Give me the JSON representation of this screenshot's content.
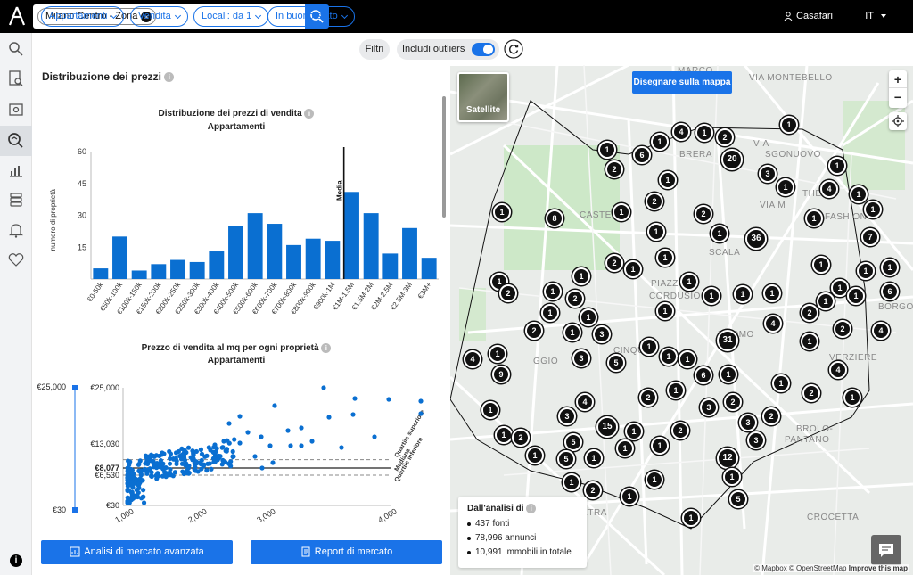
{
  "topbar": {
    "search_chip": "Milano Centro - Zona",
    "user": "Casafari",
    "lang": "IT"
  },
  "filters": {
    "items": [
      "Appartamenti",
      "Vendita",
      "Locali: da 1",
      "In buono stato"
    ],
    "filtri": "Filtri",
    "outliers": "Includi outliers"
  },
  "section_title": "Distribuzione dei prezzi",
  "chart1_title": "Distribuzione dei prezzi di vendita",
  "chart1_subtitle": "Appartamenti",
  "chart2_title": "Prezzo di vendita al mq per ogni proprietà",
  "chart2_subtitle": "Appartamenti",
  "chart_data": [
    {
      "type": "bar",
      "title": "Distribuzione dei prezzi di vendita",
      "subtitle": "Appartamenti",
      "ylabel": "numero di proprietà",
      "xlabel": "",
      "categories": [
        "€0-50k",
        "€50k-100k",
        "€100k-150k",
        "€150k-200k",
        "€200k-250k",
        "€250k-300k",
        "€300k-400k",
        "€400k-500k",
        "€500k-600k",
        "€600k-700k",
        "€700k-800k",
        "€800k-900k",
        "€900k-1M",
        "€1M-1.5M",
        "€1.5M-2M",
        "€2M-2.5M",
        "€2.5M-3M",
        "€3M+"
      ],
      "values": [
        5,
        20,
        4,
        7,
        9,
        8,
        13,
        25,
        31,
        26,
        16,
        19,
        18,
        41,
        31,
        12,
        24,
        10
      ],
      "ylim": [
        0,
        60
      ],
      "yticks": [
        15,
        30,
        45,
        60
      ],
      "median_label": "Media",
      "median_category_index": 13,
      "color": "#0a6fd1",
      "grid": false
    },
    {
      "type": "scatter",
      "title": "Prezzo di vendita al mq per ogni proprietà",
      "subtitle": "Appartamenti",
      "ytick_labels": [
        "€25,000",
        "€13,030",
        "€8,077",
        "€6,530",
        "€30"
      ],
      "ytick_values": [
        25000,
        13030,
        8077,
        6530,
        30
      ],
      "xtick_labels": [
        "1,000",
        "2,000",
        "3,000",
        "4,000"
      ],
      "median": 8077,
      "upper_quartile": 9800,
      "lower_quartile": 6530,
      "line_labels": [
        "Quartile superiore",
        "Mediana",
        "Quartile inferiore"
      ],
      "slider_labels": [
        "€25,000",
        "€30"
      ],
      "color": "#0a6fd1"
    }
  ],
  "buttons": {
    "analysis": "Analisi di mercato avanzata",
    "report": "Report di mercato"
  },
  "map": {
    "satellite": "Satellite",
    "draw": "Disegnare sulla mappa",
    "zoom_in": "+",
    "zoom_out": "−",
    "analysis_title": "Dall'analisi di",
    "analysis_items": [
      "437 fonti",
      "78,996 annunci",
      "10,991 immobili in totale"
    ],
    "attribution": "© Mapbox © OpenStreetMap",
    "improve": "Improve this map",
    "labels": [
      "MARCO",
      "VIA MONTEBELLO",
      "BRERA",
      "VIA",
      "SGONUOVO",
      "CASTELLO",
      "SCALA",
      "PIAZZA",
      "CORDUSIO",
      "DUOMO",
      "CINQUE",
      "VERZIERE",
      "BROLO-",
      "PANTANO",
      "CROCETTA",
      "VETRA",
      "BORGOGNA",
      "THE",
      "FASHION",
      "GGIO",
      "VIA M"
    ],
    "clusters": [
      {
        "n": "1",
        "x": 681,
        "y": 168
      },
      {
        "n": "6",
        "x": 720,
        "y": 174
      },
      {
        "n": "1",
        "x": 740,
        "y": 159
      },
      {
        "n": "4",
        "x": 764,
        "y": 148
      },
      {
        "n": "1",
        "x": 790,
        "y": 149
      },
      {
        "n": "2",
        "x": 813,
        "y": 154
      },
      {
        "n": "1",
        "x": 885,
        "y": 140
      },
      {
        "n": "2",
        "x": 689,
        "y": 190
      },
      {
        "n": "20",
        "x": 821,
        "y": 179
      },
      {
        "n": "1",
        "x": 749,
        "y": 202
      },
      {
        "n": "3",
        "x": 861,
        "y": 195
      },
      {
        "n": "1",
        "x": 939,
        "y": 186
      },
      {
        "n": "1",
        "x": 881,
        "y": 210
      },
      {
        "n": "4",
        "x": 930,
        "y": 212
      },
      {
        "n": "1",
        "x": 963,
        "y": 218
      },
      {
        "n": "1",
        "x": 563,
        "y": 238
      },
      {
        "n": "8",
        "x": 622,
        "y": 245
      },
      {
        "n": "1",
        "x": 697,
        "y": 238
      },
      {
        "n": "2",
        "x": 734,
        "y": 226
      },
      {
        "n": "2",
        "x": 789,
        "y": 240
      },
      {
        "n": "1",
        "x": 913,
        "y": 245
      },
      {
        "n": "1",
        "x": 979,
        "y": 235
      },
      {
        "n": "1",
        "x": 736,
        "y": 260
      },
      {
        "n": "1",
        "x": 807,
        "y": 262
      },
      {
        "n": "36",
        "x": 848,
        "y": 268
      },
      {
        "n": "7",
        "x": 976,
        "y": 266
      },
      {
        "n": "1",
        "x": 746,
        "y": 289
      },
      {
        "n": "2",
        "x": 689,
        "y": 295
      },
      {
        "n": "1",
        "x": 710,
        "y": 302
      },
      {
        "n": "1",
        "x": 921,
        "y": 297
      },
      {
        "n": "1",
        "x": 971,
        "y": 304
      },
      {
        "n": "1",
        "x": 998,
        "y": 300
      },
      {
        "n": "1",
        "x": 652,
        "y": 310
      },
      {
        "n": "1",
        "x": 773,
        "y": 316
      },
      {
        "n": "1",
        "x": 560,
        "y": 316
      },
      {
        "n": "2",
        "x": 570,
        "y": 329
      },
      {
        "n": "1",
        "x": 620,
        "y": 327
      },
      {
        "n": "2",
        "x": 645,
        "y": 335
      },
      {
        "n": "1",
        "x": 798,
        "y": 332
      },
      {
        "n": "1",
        "x": 833,
        "y": 330
      },
      {
        "n": "1",
        "x": 866,
        "y": 329
      },
      {
        "n": "1",
        "x": 942,
        "y": 323
      },
      {
        "n": "1",
        "x": 960,
        "y": 332
      },
      {
        "n": "6",
        "x": 998,
        "y": 327
      },
      {
        "n": "1",
        "x": 926,
        "y": 338
      },
      {
        "n": "1",
        "x": 617,
        "y": 351
      },
      {
        "n": "1",
        "x": 660,
        "y": 356
      },
      {
        "n": "1",
        "x": 746,
        "y": 349
      },
      {
        "n": "2",
        "x": 908,
        "y": 351
      },
      {
        "n": "4",
        "x": 867,
        "y": 363
      },
      {
        "n": "2",
        "x": 599,
        "y": 371
      },
      {
        "n": "1",
        "x": 642,
        "y": 373
      },
      {
        "n": "3",
        "x": 675,
        "y": 375
      },
      {
        "n": "2",
        "x": 945,
        "y": 369
      },
      {
        "n": "4",
        "x": 988,
        "y": 371
      },
      {
        "n": "31",
        "x": 816,
        "y": 382
      },
      {
        "n": "1",
        "x": 908,
        "y": 383
      },
      {
        "n": "1",
        "x": 558,
        "y": 397
      },
      {
        "n": "4",
        "x": 530,
        "y": 403
      },
      {
        "n": "3",
        "x": 652,
        "y": 402
      },
      {
        "n": "1",
        "x": 728,
        "y": 389
      },
      {
        "n": "1",
        "x": 750,
        "y": 400
      },
      {
        "n": "1",
        "x": 771,
        "y": 403
      },
      {
        "n": "5",
        "x": 691,
        "y": 407
      },
      {
        "n": "9",
        "x": 562,
        "y": 420
      },
      {
        "n": "6",
        "x": 789,
        "y": 421
      },
      {
        "n": "1",
        "x": 817,
        "y": 420
      },
      {
        "n": "4",
        "x": 940,
        "y": 415
      },
      {
        "n": "1",
        "x": 876,
        "y": 430
      },
      {
        "n": "1",
        "x": 758,
        "y": 438
      },
      {
        "n": "2",
        "x": 727,
        "y": 446
      },
      {
        "n": "2",
        "x": 910,
        "y": 441
      },
      {
        "n": "1",
        "x": 956,
        "y": 446
      },
      {
        "n": "4",
        "x": 656,
        "y": 451
      },
      {
        "n": "2",
        "x": 822,
        "y": 451
      },
      {
        "n": "3",
        "x": 795,
        "y": 457
      },
      {
        "n": "1",
        "x": 550,
        "y": 460
      },
      {
        "n": "3",
        "x": 636,
        "y": 467
      },
      {
        "n": "2",
        "x": 865,
        "y": 467
      },
      {
        "n": "3",
        "x": 839,
        "y": 474
      },
      {
        "n": "15",
        "x": 681,
        "y": 479
      },
      {
        "n": "1",
        "x": 711,
        "y": 484
      },
      {
        "n": "2",
        "x": 763,
        "y": 483
      },
      {
        "n": "1",
        "x": 565,
        "y": 488
      },
      {
        "n": "2",
        "x": 584,
        "y": 491
      },
      {
        "n": "3",
        "x": 848,
        "y": 494
      },
      {
        "n": "5",
        "x": 643,
        "y": 496
      },
      {
        "n": "1",
        "x": 701,
        "y": 503
      },
      {
        "n": "1",
        "x": 740,
        "y": 500
      },
      {
        "n": "1",
        "x": 600,
        "y": 511
      },
      {
        "n": "5",
        "x": 635,
        "y": 515
      },
      {
        "n": "1",
        "x": 666,
        "y": 514
      },
      {
        "n": "12",
        "x": 816,
        "y": 514
      },
      {
        "n": "1",
        "x": 734,
        "y": 538
      },
      {
        "n": "1",
        "x": 821,
        "y": 535
      },
      {
        "n": "1",
        "x": 641,
        "y": 541
      },
      {
        "n": "2",
        "x": 665,
        "y": 550
      },
      {
        "n": "1",
        "x": 706,
        "y": 557
      },
      {
        "n": "5",
        "x": 828,
        "y": 560
      },
      {
        "n": "1",
        "x": 775,
        "y": 581
      }
    ]
  },
  "sidebar_icons": [
    "search-icon",
    "document-search-icon",
    "report-icon",
    "market-search-icon",
    "chart-icon",
    "stack-icon",
    "bell-icon",
    "heart-icon"
  ]
}
